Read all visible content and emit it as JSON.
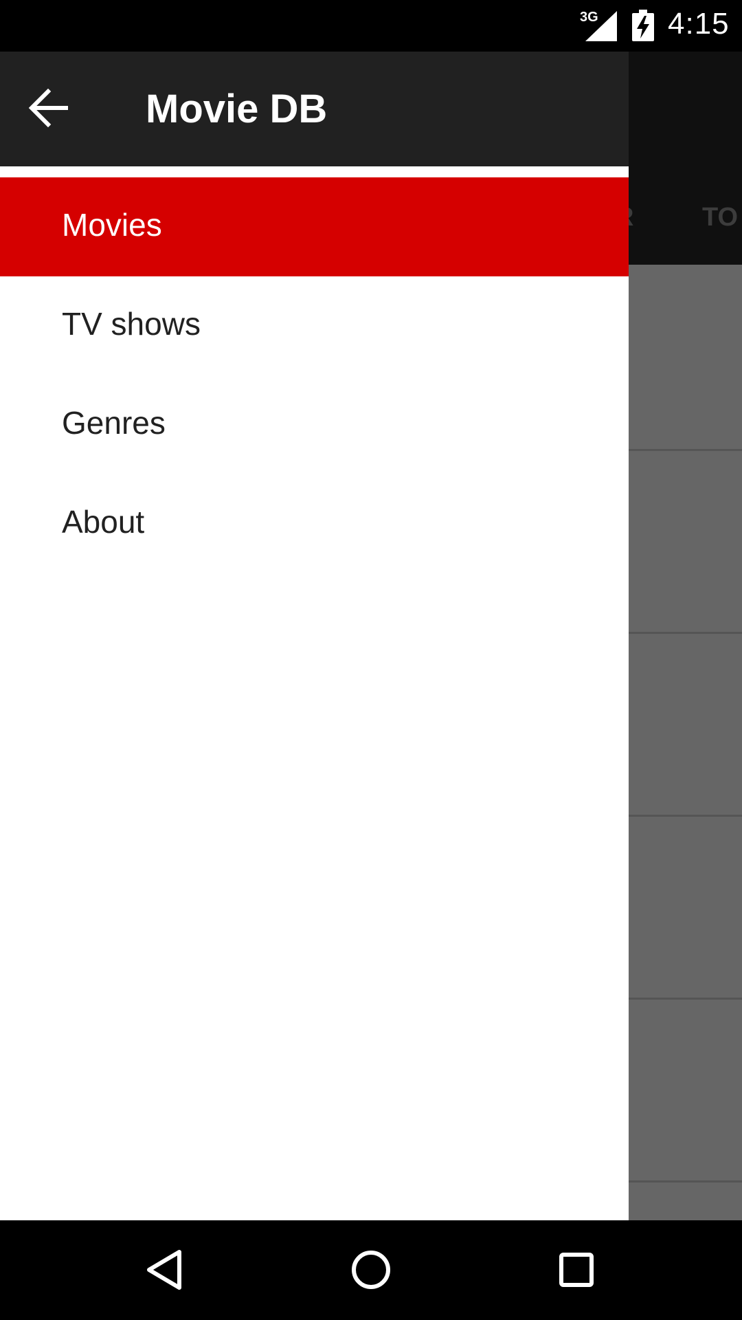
{
  "status_bar": {
    "network": "3G",
    "time": "4:15",
    "icons": [
      "signal-icon",
      "battery-charging-icon"
    ]
  },
  "background_app": {
    "tabs": [
      "R",
      "TO"
    ]
  },
  "drawer": {
    "title": "Movie DB",
    "back_icon": "arrow-back-icon",
    "items": [
      {
        "label": "Movies",
        "active": true
      },
      {
        "label": "TV shows",
        "active": false
      },
      {
        "label": "Genres",
        "active": false
      },
      {
        "label": "About",
        "active": false
      }
    ]
  },
  "nav_bar": {
    "icons": [
      "back-triangle-icon",
      "home-circle-icon",
      "recents-square-icon"
    ]
  },
  "colors": {
    "accent": "#d50000",
    "header": "#212121",
    "status_bar": "#000000",
    "scrim_content": "#666666"
  }
}
